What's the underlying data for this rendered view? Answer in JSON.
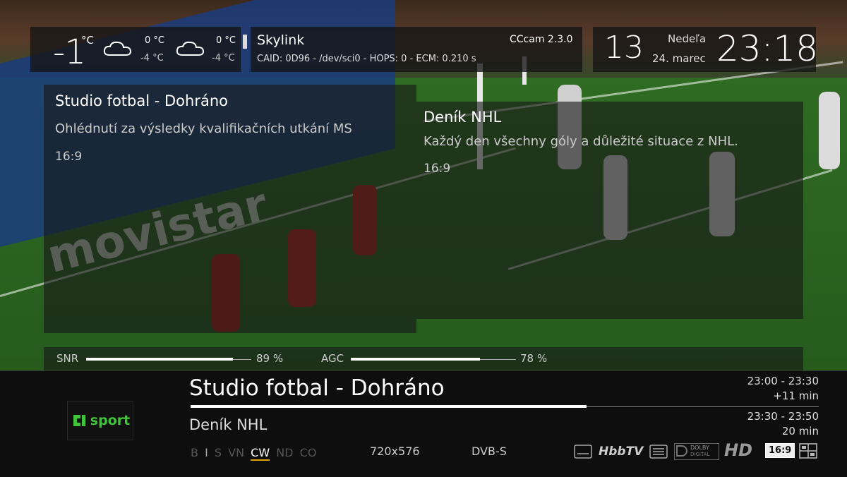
{
  "weather": {
    "current_temp": "-1",
    "unit": "°C",
    "today": {
      "high": "0 °C",
      "low": "-4 °C"
    },
    "tomorrow": {
      "high": "0 °C",
      "low": "-4 °C"
    }
  },
  "signal_info": {
    "provider": "Skylink",
    "details": "CAID: 0D96 - /dev/sci0 - HOPS: 0 - ECM: 0.210 s",
    "softcam": "CCcam 2.3.0"
  },
  "clock": {
    "channel_number": "13",
    "day": "Nedeľa",
    "date": "24. marec",
    "time": "23:18"
  },
  "current_program": {
    "title": "Studio fotbal - Dohráno",
    "description": "Ohlédnutí za výsledky kvalifikačních utkání MS",
    "aspect": "16:9"
  },
  "next_program": {
    "title": "Deník NHL",
    "description": "Každý den všechny góly a důležité situace z NHL.",
    "aspect": "16:9"
  },
  "tuner": {
    "snr_label": "SNR",
    "snr_value": "89 %",
    "snr_fraction": 0.89,
    "agc_label": "AGC",
    "agc_value": "78 %",
    "agc_fraction": 0.78
  },
  "infobar": {
    "channel_logo": "sport",
    "now_title": "Studio fotbal - Dohráno",
    "now_time": "23:00 - 23:30",
    "now_remaining": "+11 min",
    "now_progress": 0.63,
    "next_title": "Deník NHL",
    "next_time": "23:30 - 23:50",
    "next_duration": "20 min",
    "ca_flags": [
      "B",
      "I",
      "S",
      "VN",
      "CW",
      "ND",
      "CO"
    ],
    "active_flag": "CW",
    "resolution": "720x576",
    "system": "DVB-S",
    "icons": {
      "hbbtv": "HbbTV",
      "dolby_top": "DOLBY",
      "dolby_bottom": "DIGITAL",
      "hd": "HD",
      "aspect": "16:9"
    }
  }
}
